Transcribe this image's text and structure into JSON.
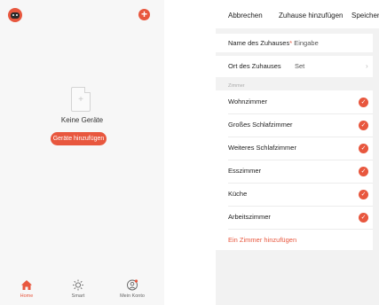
{
  "home": {
    "empty_text": "Keine Geräte",
    "add_devices_label": "Geräte hinzufügen",
    "tabs": [
      {
        "label": "Home",
        "icon": "home-icon"
      },
      {
        "label": "Smart",
        "icon": "sun-icon"
      },
      {
        "label": "Mein Konto",
        "icon": "user-icon"
      }
    ]
  },
  "add_home": {
    "cancel_label": "Abbrechen",
    "title": "Zuhause hinzufügen",
    "save_label": "Speichern",
    "name_label": "Name des Zuhauses",
    "name_required_mark": "*",
    "name_placeholder": "Eingabe",
    "location_label": "Ort des Zuhauses",
    "location_value": "Set",
    "rooms_section": "Zimmer",
    "rooms": [
      "Wohnzimmer",
      "Großes Schlafzimmer",
      "Weiteres Schlafzimmer",
      "Esszimmer",
      "Küche",
      "Arbeitszimmer"
    ],
    "add_room_label": "Ein Zimmer hinzufügen"
  },
  "colors": {
    "accent": "#e8573e"
  }
}
